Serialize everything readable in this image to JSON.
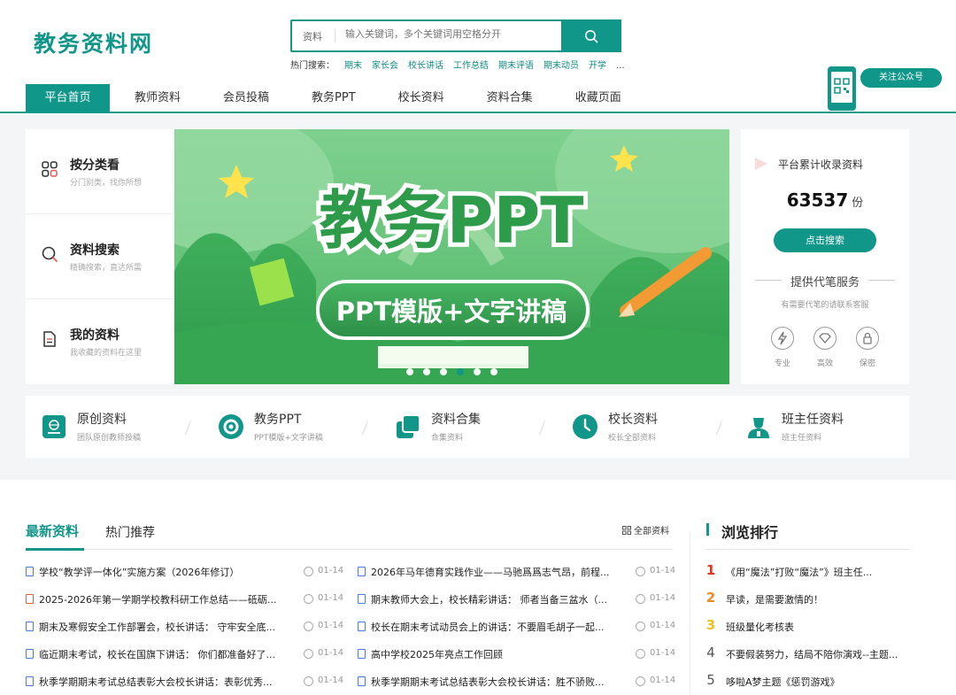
{
  "brand": {
    "logo_text": "教务资料网",
    "accent": "#11968a"
  },
  "search": {
    "scope": "资料",
    "placeholder": "输入关键词，多个关键词用空格分开"
  },
  "hot_search": {
    "label": "热门搜索：",
    "items": [
      "期末",
      "家长会",
      "校长讲话",
      "工作总结",
      "期末评语",
      "期末动员",
      "开学",
      "..."
    ]
  },
  "follow": {
    "label": "关注公众号"
  },
  "nav": [
    "平台首页",
    "教师资料",
    "会员投稿",
    "教务PPT",
    "校长资料",
    "资料合集",
    "收藏页面"
  ],
  "left_categories": [
    {
      "title": "按分类看",
      "subtitle": "分门别类，找你所想",
      "icon": "grid-icon"
    },
    {
      "title": "资料搜索",
      "subtitle": "精确搜索，直达所需",
      "icon": "search-icon"
    },
    {
      "title": "我的资料",
      "subtitle": "我收藏的资料在这里",
      "icon": "document-icon"
    }
  ],
  "banner": {
    "title": "教务PPT",
    "subtitle": "PPT模版+文字讲稿",
    "slide_count": 6,
    "active_slide": 4
  },
  "stats": {
    "title": "平台累计收录资料",
    "count": "63537",
    "unit": "份",
    "button": "点击搜索",
    "service_title": "提供代笔服务",
    "service_note": "有需要代笔的请联系客服",
    "features": [
      {
        "label": "专业",
        "icon": "lightning-icon"
      },
      {
        "label": "高效",
        "icon": "diamond-icon"
      },
      {
        "label": "保密",
        "icon": "lock-icon"
      }
    ]
  },
  "strip": [
    {
      "title": "原创资料",
      "subtitle": "团队原创教师投稿",
      "icon": "book-icon"
    },
    {
      "title": "教务PPT",
      "subtitle": "PPT模版+文字讲稿",
      "icon": "ppt-icon"
    },
    {
      "title": "资料合集",
      "subtitle": "合集资料",
      "icon": "stack-icon"
    },
    {
      "title": "校长资料",
      "subtitle": "校长全部资料",
      "icon": "clock-icon"
    },
    {
      "title": "班主任资料",
      "subtitle": "班主任资料",
      "icon": "teacher-icon"
    }
  ],
  "tabs": {
    "latest": "最新资料",
    "hot": "热门推荐",
    "all": "全部资料"
  },
  "latest_left": [
    {
      "title": "学校“教学评一体化”实施方案（2026年修订）",
      "date": "01-14",
      "type": "doc"
    },
    {
      "title": "2025-2026年第一学期学校教科研工作总结——砥砺...",
      "date": "01-14",
      "type": "pdf"
    },
    {
      "title": "期末及寒假安全工作部署会，校长讲话： 守牢安全底...",
      "date": "01-14",
      "type": "doc"
    },
    {
      "title": "临近期末考试，校长在国旗下讲话： 你们都准备好了...",
      "date": "01-14",
      "type": "doc"
    },
    {
      "title": "秋季学期期末考试总结表彰大会校长讲话：表彰优秀...",
      "date": "01-14",
      "type": "doc"
    }
  ],
  "latest_right": [
    {
      "title": "2026年马年德育实践作业——马驰爲爲志气昂，前程...",
      "date": "01-14",
      "type": "doc"
    },
    {
      "title": "期末教师大会上，校长精彩讲话： 师者当备三盆水（...",
      "date": "01-14",
      "type": "doc"
    },
    {
      "title": "校长在期末考试动员会上的讲话：不要眉毛胡子一起...",
      "date": "01-14",
      "type": "doc"
    },
    {
      "title": "高中学校2025年亮点工作回顾",
      "date": "01-14",
      "type": "doc"
    },
    {
      "title": "秋季学期期末考试总结表彰大会校长讲话：胜不骄败...",
      "date": "01-14",
      "type": "doc"
    }
  ],
  "ranking": {
    "title": "浏览排行",
    "items": [
      {
        "n": "1",
        "title": "《用“魔法”打败“魔法”》班主任...",
        "color": "#e8321e"
      },
      {
        "n": "2",
        "title": "早读，是需要激情的！",
        "color": "#f08a1c"
      },
      {
        "n": "3",
        "title": "班级量化考核表",
        "color": "#f2c11b"
      },
      {
        "n": "4",
        "title": "不要假装努力，结局不陪你演戏--主题...",
        "color": "#555555"
      },
      {
        "n": "5",
        "title": "哆啦A梦主题《惩罚游戏》",
        "color": "#555555"
      }
    ]
  }
}
